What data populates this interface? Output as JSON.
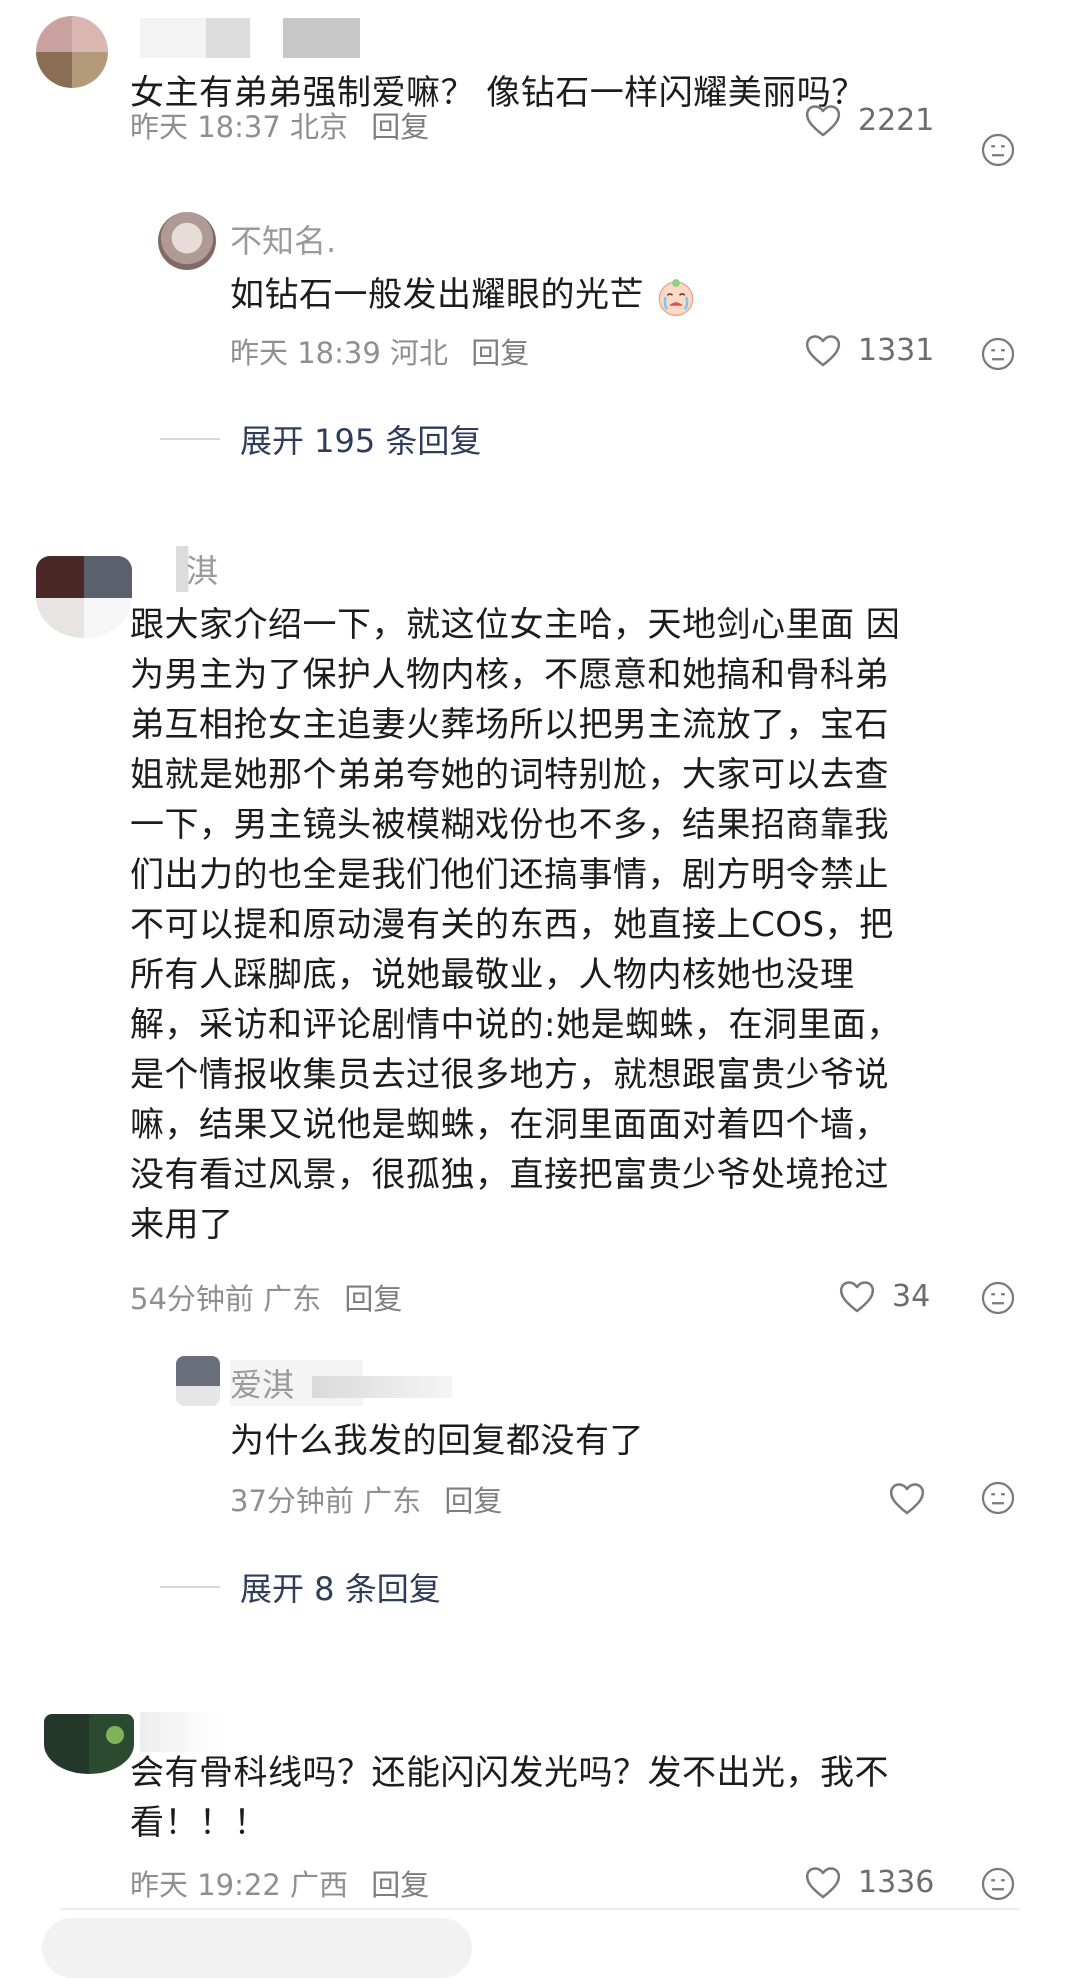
{
  "comments": [
    {
      "id": "c1",
      "text": "女主有弟弟强制爱嘛？ 像钻石一样闪耀美丽吗？",
      "time": "昨天 18:37",
      "location": "北京",
      "reply_label": "回复",
      "likes": "2221",
      "sub": {
        "name": "不知名.",
        "text": "如钻石一般发出耀眼的光芒",
        "emoji": "crying-face",
        "time": "昨天 18:39",
        "location": "河北",
        "reply_label": "回复",
        "likes": "1331"
      },
      "expand": "展开 195 条回复"
    },
    {
      "id": "c2",
      "name_visible": "淇",
      "text_lines": [
        "跟大家介绍一下，就这位女主哈，天地剑心里面 因",
        "为男主为了保护人物内核，不愿意和她搞和骨科弟",
        "弟互相抢女主追妻火葬场所以把男主流放了，宝石",
        "姐就是她那个弟弟夸她的词特别尬，大家可以去查",
        "一下，男主镜头被模糊戏份也不多，结果招商靠我",
        "们出力的也全是我们他们还搞事情，剧方明令禁止",
        "不可以提和原动漫有关的东西，她直接上COS，把",
        "所有人踩脚底，说她最敬业，人物内核她也没理",
        "解，采访和评论剧情中说的:她是蜘蛛，在洞里面，",
        "是个情报收集员去过很多地方，就想跟富贵少爷说",
        "嘛，结果又说他是蜘蛛，在洞里面面对着四个墙，",
        "没有看过风景，很孤独，直接把富贵少爷处境抢过",
        "来用了"
      ],
      "time": "54分钟前",
      "location": "广东",
      "reply_label": "回复",
      "likes": "34",
      "sub": {
        "name_visible": "爱淇",
        "text": "为什么我发的回复都没有了",
        "time": "37分钟前",
        "location": "广东",
        "reply_label": "回复"
      },
      "expand": "展开 8 条回复"
    },
    {
      "id": "c3",
      "text_lines": [
        "会有骨科线吗？还能闪闪发光吗？发不出光，我不",
        "看！！！"
      ],
      "time": "昨天 19:22",
      "location": "广西",
      "reply_label": "回复",
      "likes": "1336"
    }
  ],
  "icons": {
    "like": "heart-outline-icon",
    "dislike": "meh-face-icon"
  },
  "colors": {
    "text": "#1c1c1c",
    "meta": "#8f8f8f",
    "expand_text": "#2f3d5b"
  }
}
